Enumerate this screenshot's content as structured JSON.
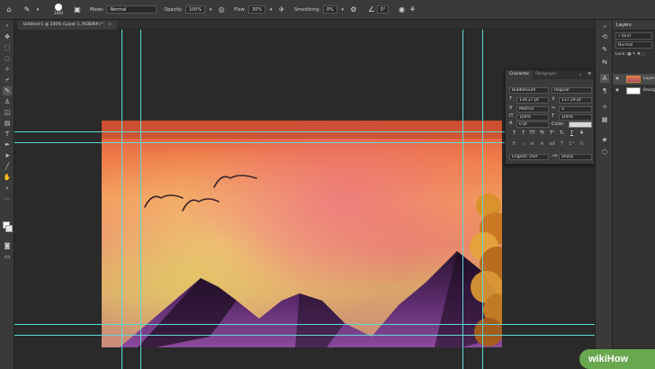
{
  "options_bar": {
    "brush_size": "2840",
    "mode_label": "Mode:",
    "mode_value": "Normal",
    "opacity_label": "Opacity:",
    "opacity_value": "100%",
    "flow_label": "Flow:",
    "flow_value": "30%",
    "smoothing_label": "Smoothing:",
    "smoothing_value": "0%",
    "angle_value": "0°"
  },
  "document": {
    "tab_title": "Untitled-1 @ 100% (Layer 1, RGB/8#) *",
    "close": "×"
  },
  "character_panel": {
    "tab_character": "Character",
    "tab_paragraph": "Paragraph",
    "font_family": "BubbleGum",
    "font_style": "Regular",
    "font_size": "130.27 pt",
    "leading": "137.29 pt",
    "kerning": "Metrics",
    "tracking": "0",
    "vertical_scale": "100%",
    "horizontal_scale": "100%",
    "baseline_shift": "0 pt",
    "color_label": "Color:",
    "language": "English: USA",
    "antialias_icon": "aa",
    "antialias": "Sharp"
  },
  "layers_panel": {
    "title": "Layers",
    "filter_kind": "Kind",
    "blend_mode": "Normal",
    "lock_label": "Lock:",
    "layers": [
      {
        "name": "Layer 1"
      },
      {
        "name": "Background"
      }
    ]
  },
  "watermark": {
    "wiki": "wiki",
    "how": "How"
  },
  "colors": {
    "guide": "#5fd7d7",
    "panel_bg": "#3a3a3a",
    "canvas_bg": "#2a2a2a",
    "watermark_green": "#6aa84f"
  }
}
